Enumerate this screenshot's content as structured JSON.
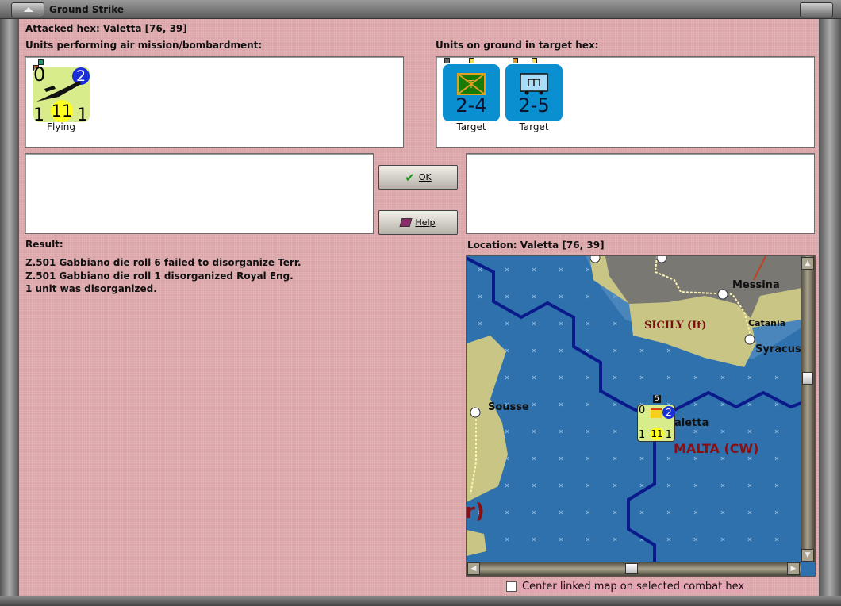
{
  "window": {
    "title": "Ground Strike"
  },
  "header": {
    "attacked_hex": "Attacked hex: Valetta  [76, 39]"
  },
  "attackers": {
    "label": "Units performing air mission/bombardment:",
    "units": [
      {
        "top_left": "0",
        "badge": "2",
        "bottom_left": "1",
        "center": "11",
        "bottom_right": "1",
        "caption": "Flying",
        "icon": "bomber-aircraft-icon"
      }
    ]
  },
  "defenders": {
    "label": "Units on ground in target hex:",
    "units": [
      {
        "strength": "2-4",
        "caption": "Target",
        "icon": "territorial-infantry-icon"
      },
      {
        "strength": "2-5",
        "caption": "Target",
        "icon": "engineer-icon"
      }
    ]
  },
  "buttons": {
    "ok": "OK",
    "help": "Help"
  },
  "result": {
    "label": "Result:",
    "lines": [
      "Z.501 Gabbiano die roll 6 failed to disorganize Terr.",
      "Z.501 Gabbiano die roll 1 disorganized Royal Eng.",
      "1 unit was disorganized."
    ]
  },
  "location": {
    "label": "Location:  Valetta  [76, 39]"
  },
  "map": {
    "labels": {
      "messina": "Messina",
      "catania": "Catania",
      "syracuse": "Syracus",
      "sicily": "SICILY (It)",
      "sousse": "Sousse",
      "valetta": "aletta",
      "malta": "MALTA (CW)",
      "partial": "r)"
    },
    "unit": {
      "stack": "5",
      "top_left": "0",
      "badge": "2",
      "bottom_left": "1",
      "center": "11",
      "bottom_right": "1"
    }
  },
  "checkbox": {
    "label": "Center linked map on selected combat hex",
    "checked": false
  },
  "colors": {
    "background": "#dba6aa",
    "sea": "#2f71ad",
    "counter_blue": "#0a8fd0",
    "counter_yellow": "#d8ec8c"
  }
}
